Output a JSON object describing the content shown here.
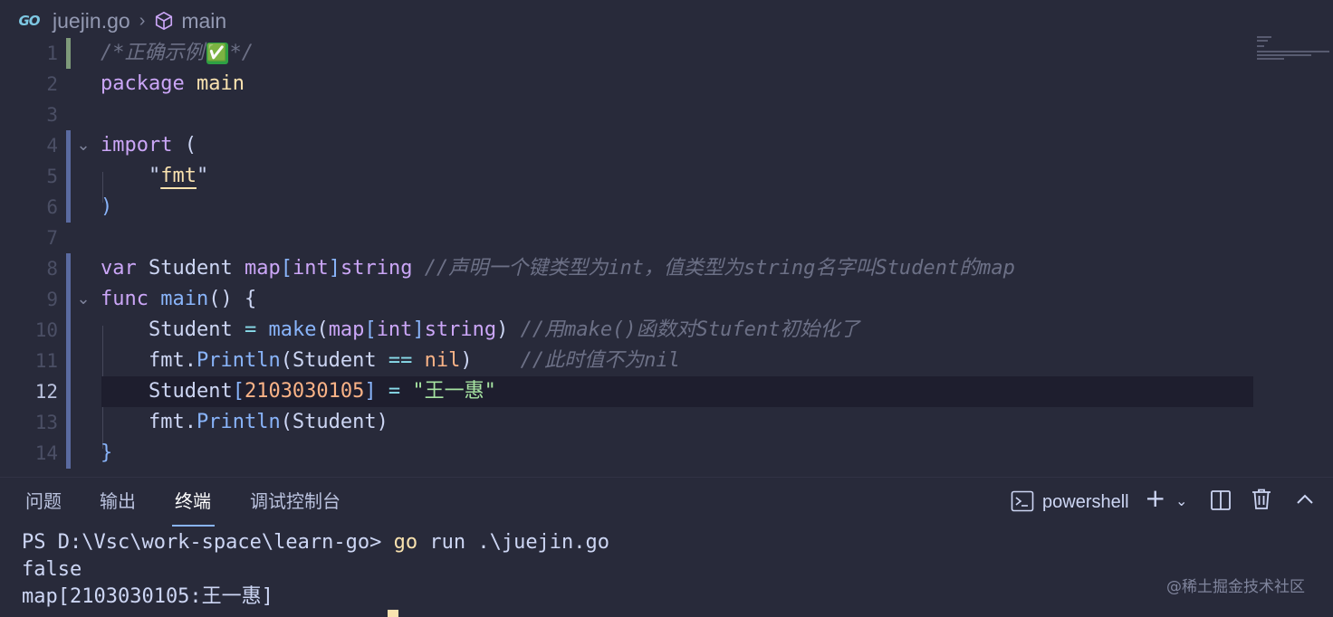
{
  "breadcrumb": {
    "file": "juejin.go",
    "symbol": "main",
    "file_icon": "go-file-icon",
    "symbol_icon": "cube-icon"
  },
  "editor": {
    "current_line": 12,
    "lines": {
      "l1": {
        "n": "1",
        "c1": "/*正确示例",
        "c2": "✅",
        "c3": "*/"
      },
      "l2": {
        "n": "2",
        "k": "package",
        "p": "main"
      },
      "l3": {
        "n": "3"
      },
      "l4": {
        "n": "4",
        "k": "import",
        "t": " ("
      },
      "l5": {
        "n": "5",
        "q1": "\"",
        "s": "fmt",
        "q2": "\""
      },
      "l6": {
        "n": "6",
        "t": ")"
      },
      "l7": {
        "n": "7"
      },
      "l8": {
        "n": "8",
        "k": "var",
        "name": "Student",
        "map": "map",
        "b1": "[",
        "int": "int",
        "b2": "]",
        "str": "string",
        "cm": "//声明一个键类型为int，值类型为string名字叫Student的map"
      },
      "l9": {
        "n": "9",
        "k": "func",
        "fn": "main",
        "t": "() {"
      },
      "l10": {
        "n": "10",
        "name": "Student",
        "eq": "=",
        "fn": "make",
        "p1": "(",
        "map": "map",
        "b1": "[",
        "int": "int",
        "b2": "]",
        "str": "string",
        "p2": ")",
        "cm": "//用make()函数对Stufent初始化了"
      },
      "l11": {
        "n": "11",
        "pkg": "fmt.",
        "fn": "Println",
        "p1": "(",
        "name": "Student",
        "eq": "==",
        "nil": "nil",
        "p2": ")",
        "cm": "//此时值不为nil"
      },
      "l12": {
        "n": "12",
        "name": "Student",
        "b1": "[",
        "num": "2103030105",
        "b2": "]",
        "eq": "=",
        "str": "\"王一惠\""
      },
      "l13": {
        "n": "13",
        "pkg": "fmt.",
        "fn": "Println",
        "t": "(Student)"
      },
      "l14": {
        "n": "14",
        "t": "}"
      }
    }
  },
  "panel": {
    "tabs": [
      "问题",
      "输出",
      "终端",
      "调试控制台"
    ],
    "active_tab": "终端",
    "shell": "powershell"
  },
  "terminal": {
    "prompt": "PS D:\\Vsc\\work-space\\learn-go> ",
    "cmd_go": "go",
    "cmd_rest": " run .\\juejin.go",
    "out1": "false",
    "out2": "map[2103030105:王一惠]"
  },
  "watermark": "@稀土掘金技术社区",
  "colors": {
    "bg": "#282a3a",
    "keyword": "#cba6f7",
    "function": "#89b4fa",
    "string": "#a6e3a1",
    "number": "#fab387",
    "comment": "#6c7086",
    "accent": "#89b4fa"
  }
}
